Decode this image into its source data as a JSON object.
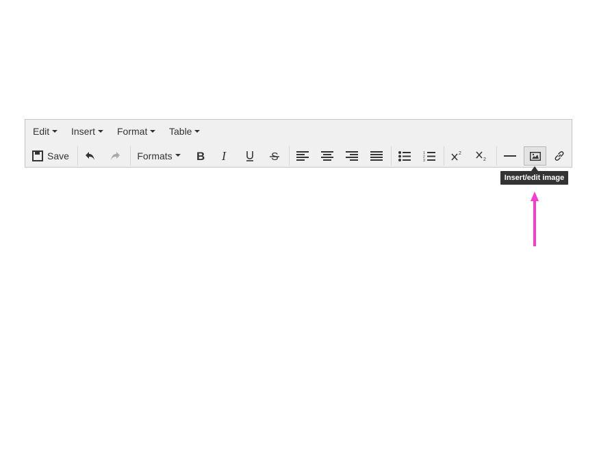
{
  "menubar": {
    "items": [
      {
        "label": "Edit"
      },
      {
        "label": "Insert"
      },
      {
        "label": "Format"
      },
      {
        "label": "Table"
      }
    ]
  },
  "toolbar": {
    "save_label": "Save",
    "formats_label": "Formats",
    "buttons": [
      {
        "icon": "save-icon"
      },
      {
        "icon": "undo-icon"
      },
      {
        "icon": "redo-icon",
        "state": "disabled"
      },
      {
        "icon": "bold-icon"
      },
      {
        "icon": "italic-icon"
      },
      {
        "icon": "underline-icon"
      },
      {
        "icon": "strikethrough-icon"
      },
      {
        "icon": "align-left-icon"
      },
      {
        "icon": "align-center-icon"
      },
      {
        "icon": "align-right-icon"
      },
      {
        "icon": "align-justify-icon"
      },
      {
        "icon": "bullet-list-icon"
      },
      {
        "icon": "numbered-list-icon"
      },
      {
        "icon": "superscript-icon"
      },
      {
        "icon": "subscript-icon"
      },
      {
        "icon": "horizontal-rule-icon"
      },
      {
        "icon": "image-icon",
        "state": "hovered"
      },
      {
        "icon": "link-icon"
      }
    ]
  },
  "tooltip": {
    "text": "Insert/edit image"
  },
  "annotation": {
    "arrow_color": "#f23fd0"
  },
  "colors": {
    "toolbar_bg": "#f0f0f0",
    "border": "#c5c5c5",
    "tooltip_bg": "#333333"
  }
}
